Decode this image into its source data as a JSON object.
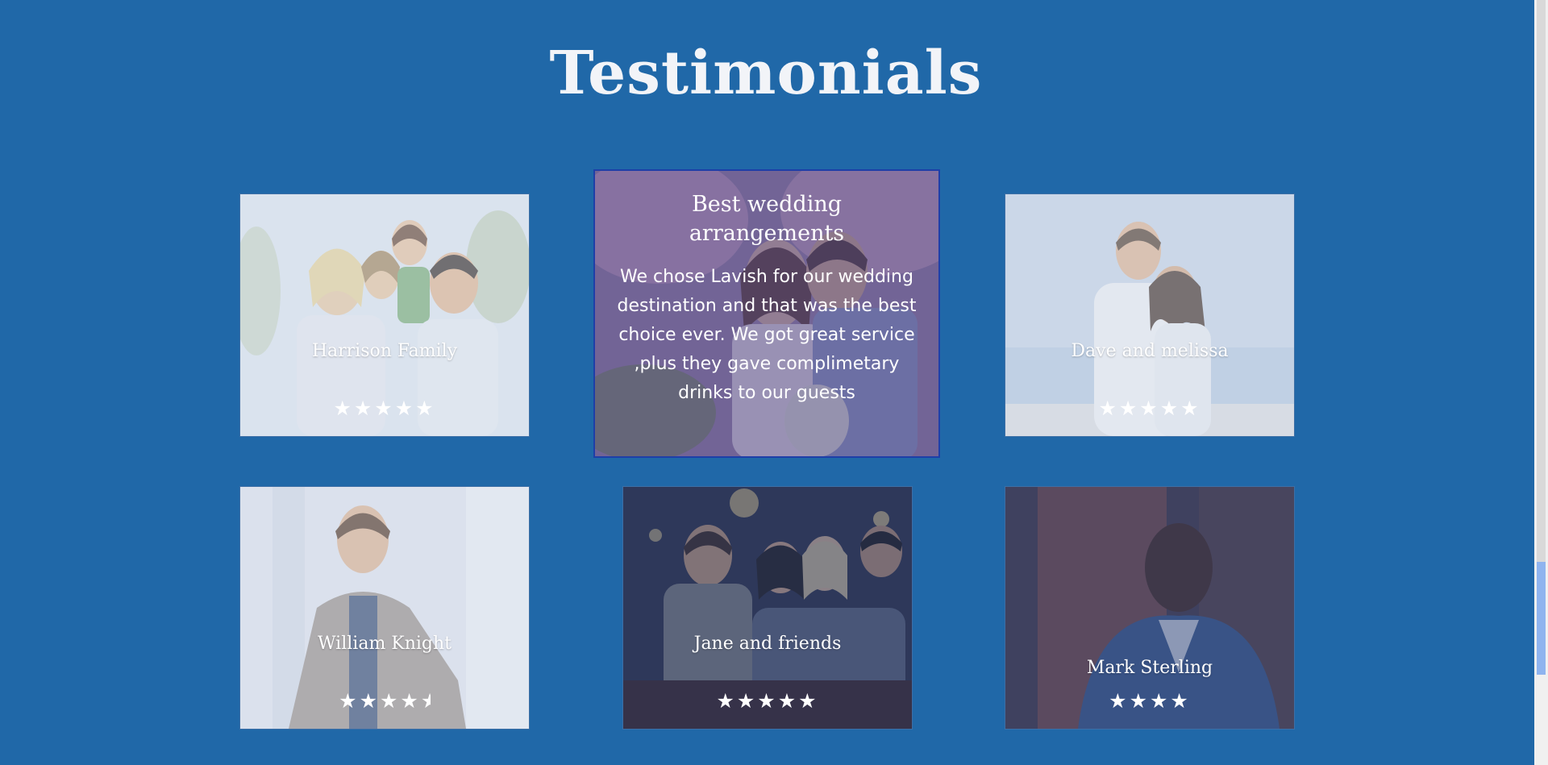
{
  "page": {
    "title": "Testimonials",
    "background_color": "#2068a8"
  },
  "featured": {
    "title": "Best wedding arrangements",
    "text": "We chose Lavish for our wedding destination and that was the best choice ever. We got great service ,plus they gave complimetary drinks to our guests",
    "photo": "wedding-couple-with-flowers"
  },
  "testimonials": [
    {
      "name": "Harrison Family",
      "rating": 5,
      "stars": "★★★★★",
      "photo": "family-portrait"
    },
    {
      "name": "Dave and melissa",
      "rating": 5,
      "stars": "★★★★★",
      "photo": "couple-at-beach"
    },
    {
      "name": "William Knight",
      "rating": 4.5,
      "stars": "★★★★",
      "photo": "man-in-suit-jacket"
    },
    {
      "name": "Jane and friends",
      "rating": 5,
      "stars": "★★★★★",
      "photo": "friends-toasting-at-bar"
    },
    {
      "name": "Mark Sterling",
      "rating": 4,
      "stars": "★★★★",
      "photo": "man-in-blue-blazer"
    }
  ],
  "icons": {
    "star": "star-icon",
    "half_star": "half-star-icon"
  }
}
